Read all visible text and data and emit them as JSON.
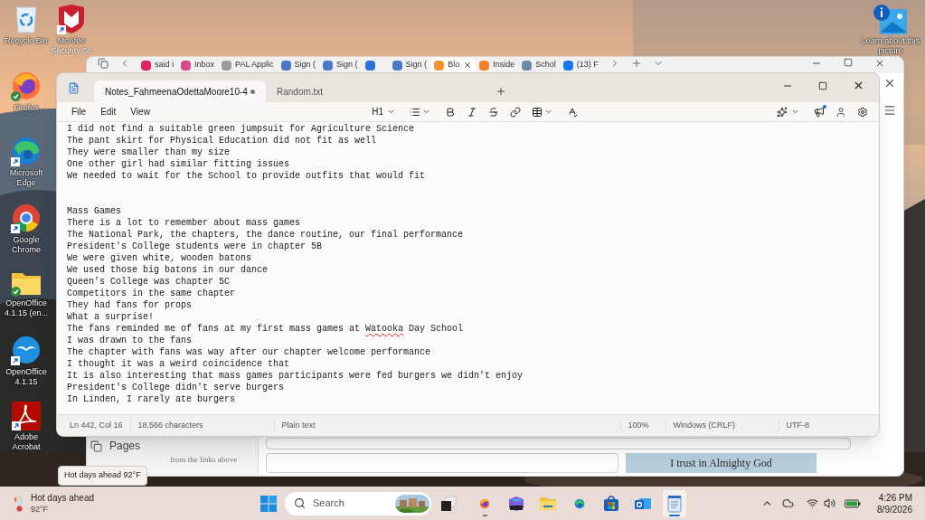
{
  "desktop_icons": [
    {
      "kind": "recycle-bin",
      "label": "Recycle Bin",
      "shortcut": false,
      "synced": false
    },
    {
      "kind": "shield",
      "label": "McAfee",
      "label_2": "Security Sc",
      "shortcut": true,
      "synced": false
    },
    {
      "kind": "firefox",
      "label": "Firefox",
      "shortcut": false,
      "synced": true
    },
    {
      "kind": "edge",
      "label": "Microsoft Edge",
      "shortcut": true,
      "synced": false
    },
    {
      "kind": "chrome",
      "label": "Google Chrome",
      "shortcut": true,
      "synced": false
    },
    {
      "kind": "folder",
      "label": "OpenOffice 4.1.15 (en...",
      "shortcut": false,
      "synced": true
    },
    {
      "kind": "openoffice",
      "label": "OpenOffice 4.1.15",
      "shortcut": true,
      "synced": false
    },
    {
      "kind": "acrobat",
      "label": "Adobe Acrobat",
      "shortcut": true,
      "synced": false
    }
  ],
  "learn_icon": {
    "label": "Learn about this picture"
  },
  "browser": {
    "tabs": [
      {
        "label": "said i",
        "color": "#e0245e",
        "selected": false
      },
      {
        "label": "Inbox",
        "color": "#d64a8a",
        "selected": false
      },
      {
        "label": "PAL Applic",
        "color": "#9a9a9a",
        "selected": false
      },
      {
        "label": "Sign (",
        "color": "#4a78c8",
        "selected": false
      },
      {
        "label": "Sign (",
        "color": "#4a78c8",
        "selected": false
      },
      {
        "color": "#2e6fd9",
        "selected": false
      },
      {
        "label": "Sign (",
        "color": "#4a78c8",
        "selected": false
      },
      {
        "label": "Blo",
        "color": "#f2952c",
        "selected": true
      },
      {
        "label": "Inside",
        "color": "#f2812c",
        "selected": false
      },
      {
        "label": "Schol",
        "color": "#6f8aa8",
        "selected": false
      },
      {
        "label": "(13) F",
        "color": "#1877f2",
        "selected": false
      }
    ],
    "sidebar_item": "Pages",
    "page_text": "from the links above",
    "banner": "I trust in Almighty God"
  },
  "notepad": {
    "tabs": [
      {
        "label": "Notes_FahmeenaOdettaMoore10-4",
        "selected": true,
        "unsaved": true
      },
      {
        "label": "Random.txt",
        "selected": false,
        "unsaved": false
      }
    ],
    "menu": [
      "File",
      "Edit",
      "View"
    ],
    "heading": "H1",
    "whats_new": true,
    "lines": [
      {
        "kind": "text",
        "parts": [
          {
            "text": "I did not find a suitable green jumpsuit for Agriculture Science",
            "misspelled": false
          }
        ]
      },
      {
        "kind": "text",
        "parts": [
          {
            "text": "The pant skirt for Physical Education did not fit as well",
            "misspelled": false
          }
        ]
      },
      {
        "kind": "text",
        "parts": [
          {
            "text": "They were smaller than my size",
            "misspelled": false
          }
        ]
      },
      {
        "kind": "text",
        "parts": [
          {
            "text": "One other girl had similar fitting issues",
            "misspelled": false
          }
        ]
      },
      {
        "kind": "text",
        "parts": [
          {
            "text": "We needed to wait for the School to provide outfits that would fit",
            "misspelled": false
          }
        ]
      },
      {
        "kind": "blank"
      },
      {
        "kind": "blank"
      },
      {
        "kind": "text",
        "parts": [
          {
            "text": "Mass Games",
            "misspelled": false
          }
        ]
      },
      {
        "kind": "text",
        "parts": [
          {
            "text": "There is a lot to remember about mass games",
            "misspelled": false
          }
        ]
      },
      {
        "kind": "text",
        "parts": [
          {
            "text": "The National Park, the chapters, the dance routine, our final performance",
            "misspelled": false
          }
        ]
      },
      {
        "kind": "text",
        "parts": [
          {
            "text": "President's College students were in chapter 5B",
            "misspelled": false
          }
        ]
      },
      {
        "kind": "text",
        "parts": [
          {
            "text": "We were given white, wooden batons",
            "misspelled": false
          }
        ]
      },
      {
        "kind": "text",
        "parts": [
          {
            "text": "We used those big batons in our dance",
            "misspelled": false
          }
        ]
      },
      {
        "kind": "text",
        "parts": [
          {
            "text": "Queen's College was chapter 5C",
            "misspelled": false
          }
        ]
      },
      {
        "kind": "text",
        "parts": [
          {
            "text": "Competitors in the same chapter",
            "misspelled": false
          }
        ]
      },
      {
        "kind": "text",
        "parts": [
          {
            "text": "They had fans for props",
            "misspelled": false
          }
        ]
      },
      {
        "kind": "text",
        "parts": [
          {
            "text": "What a surprise!",
            "misspelled": false
          }
        ]
      },
      {
        "kind": "text",
        "parts": [
          {
            "text": "The fans reminded me of fans at my first mass games at ",
            "misspelled": false
          },
          {
            "text": "Watooka",
            "misspelled": true
          },
          {
            "text": " Day School",
            "misspelled": false
          }
        ]
      },
      {
        "kind": "text",
        "parts": [
          {
            "text": "I was drawn to the fans",
            "misspelled": false
          }
        ]
      },
      {
        "kind": "text",
        "parts": [
          {
            "text": "The chapter with fans was way after our chapter welcome performance",
            "misspelled": false
          }
        ]
      },
      {
        "kind": "text",
        "parts": [
          {
            "text": "I thought it was a weird coincidence that",
            "misspelled": false
          }
        ]
      },
      {
        "kind": "text",
        "parts": [
          {
            "text": "It is also interesting that mass games participants were fed burgers we didn't enjoy",
            "misspelled": false
          }
        ]
      },
      {
        "kind": "text",
        "parts": [
          {
            "text": "President's College didn't serve burgers",
            "misspelled": false
          }
        ]
      },
      {
        "kind": "text",
        "parts": [
          {
            "text": "In Linden, I rarely ate burgers",
            "misspelled": false
          }
        ]
      }
    ],
    "status": {
      "position": "Ln 442, Col 16",
      "characters": "18,566 characters",
      "format": "Plain text",
      "zoom": "100%",
      "line_ending": "Windows (CRLF)",
      "encoding": "UTF-8"
    }
  },
  "tooltip": "Hot days ahead 92°F",
  "taskbar": {
    "weather_title": "Hot days ahead",
    "weather_temp": "92°F",
    "search_placeholder": "Search",
    "apps": [
      {
        "kind": "firefox",
        "running": true,
        "selected": false
      },
      {
        "kind": "m365",
        "running": false,
        "selected": false
      },
      {
        "kind": "files",
        "running": false,
        "selected": false
      },
      {
        "kind": "edge",
        "running": false,
        "selected": false
      },
      {
        "kind": "store",
        "running": false,
        "selected": false
      },
      {
        "kind": "outlook",
        "running": false,
        "selected": false
      },
      {
        "kind": "notepad",
        "running": true,
        "selected": true
      }
    ],
    "time": "4:26 PM",
    "date": "8/9/2026"
  }
}
